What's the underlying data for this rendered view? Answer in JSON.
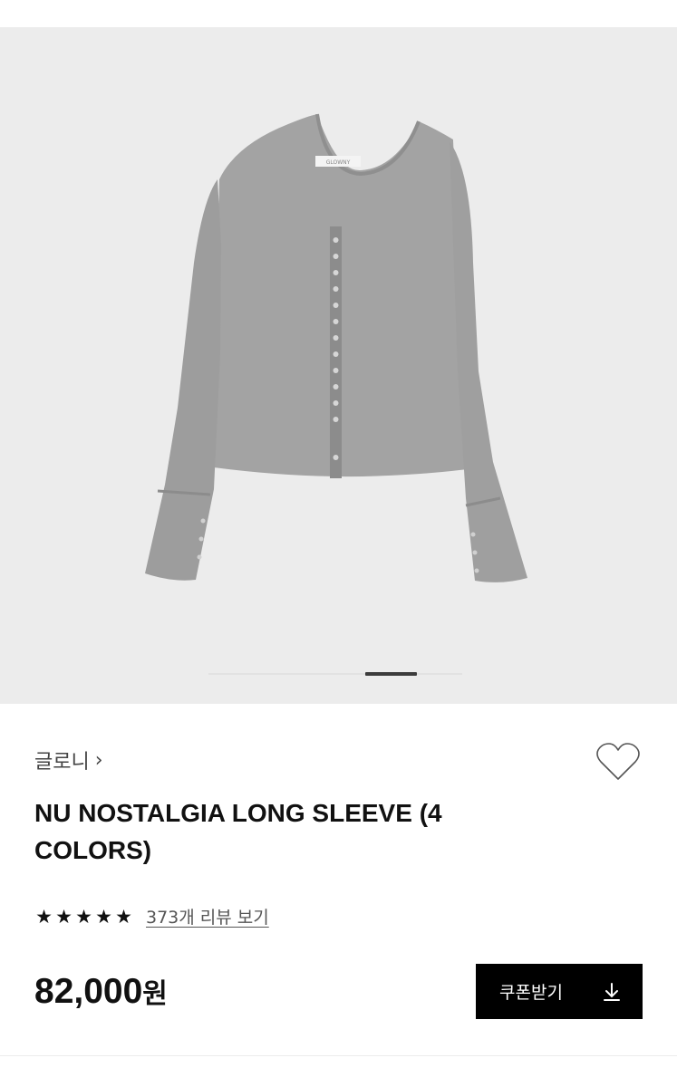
{
  "product": {
    "image_alt": "Gray button-front long sleeve top",
    "neck_label": "GLOWNY",
    "gallery_active_index": 1,
    "gallery_count": 2
  },
  "brand": {
    "name": "글로니",
    "chevron": "›"
  },
  "wishlist": {
    "icon": "heart-outline-icon"
  },
  "title": "NU NOSTALGIA LONG SLEEVE (4 COLORS)",
  "rating": {
    "stars": 5,
    "star_glyph": "★",
    "review_link": "373개 리뷰 보기"
  },
  "price": {
    "amount": "82,000",
    "unit": "원"
  },
  "coupon_button": {
    "label": "쿠폰받기",
    "icon": "download-icon"
  },
  "colors": {
    "image_bg": "#ececec",
    "garment": "#a3a3a3",
    "button": "#000000"
  }
}
